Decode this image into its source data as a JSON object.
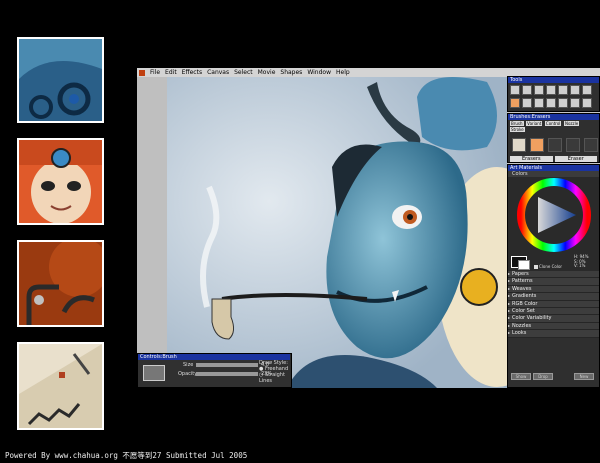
{
  "app": {
    "menu": [
      "File",
      "Edit",
      "Effects",
      "Canvas",
      "Select",
      "Movie",
      "Shapes",
      "Window",
      "Help"
    ]
  },
  "panels": {
    "tools_title": "Tools",
    "brushes_title": "Brushes:Erasers",
    "brush_tabs": [
      "Brush",
      "Variant",
      "Control",
      "Nozzle",
      "Stroke"
    ],
    "brush_name_1": "Erasers",
    "brush_name_2": "Eraser",
    "art_materials_title": "Art Materials",
    "colors_label": "Colors",
    "clone_color_label": "Clone Color",
    "hsv": {
      "h": "H: 94%",
      "s": "S: 0%",
      "v": "V: 1%"
    },
    "materials": [
      "Papers",
      "Patterns",
      "Weaves",
      "Gradients",
      "RGB Color",
      "Color Set",
      "Color Variability",
      "Nozzles",
      "Looks"
    ],
    "bottom_buttons": [
      "Show",
      "Drop",
      "New"
    ]
  },
  "controls": {
    "title": "Controls:Brush",
    "size_label": "Size",
    "size_value": "4.0",
    "opacity_label": "Opacity",
    "opacity_value": "23%",
    "draw_style_label": "Draw Style:",
    "freehand": "Freehand",
    "straight": "Straight Lines"
  },
  "footer": "Powered By www.chahua.org 不愿等到27 Submitted Jul 2005",
  "colors": {
    "title_blue": "#1a33a0",
    "panel_bg": "#2f2f2f",
    "orange": "#f0a060"
  }
}
